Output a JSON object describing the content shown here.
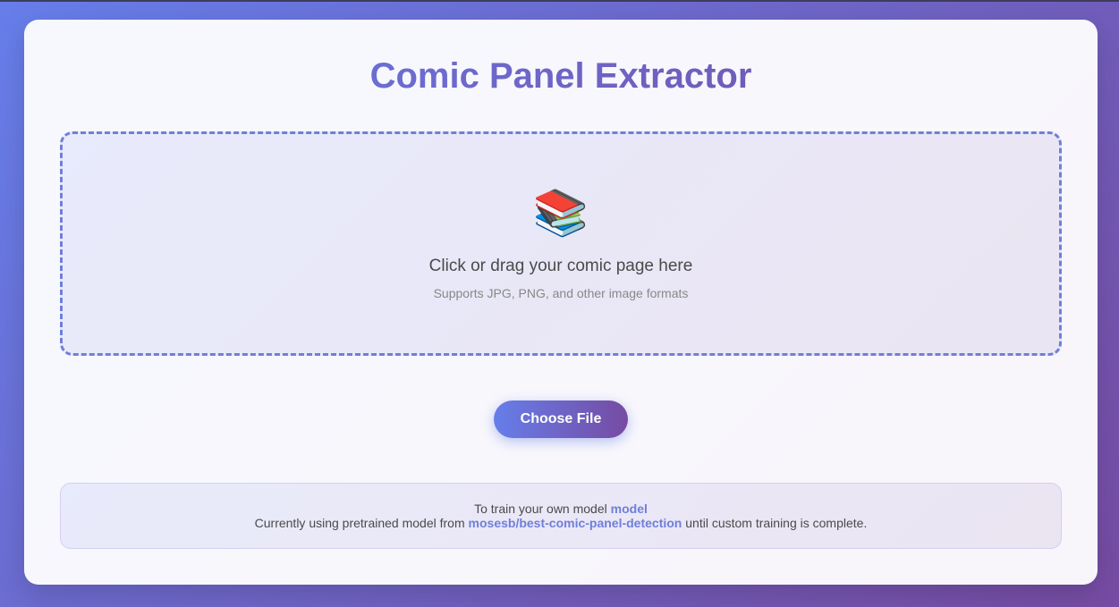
{
  "header": {
    "title": "Comic Panel Extractor"
  },
  "dropzone": {
    "icon": "books-icon",
    "icon_glyph": "📚",
    "main_text": "Click or drag your comic page here",
    "sub_text": "Supports JPG, PNG, and other image formats"
  },
  "upload": {
    "button_label": "Choose File"
  },
  "info": {
    "line1_prefix": "To train your own model",
    "line1_link": "model",
    "line2_prefix": "Currently using pretrained model from",
    "line2_link": "mosesb/best-comic-panel-detection",
    "line2_suffix": "until custom training is complete."
  },
  "colors": {
    "accent_start": "#667eea",
    "accent_end": "#764ba2"
  }
}
